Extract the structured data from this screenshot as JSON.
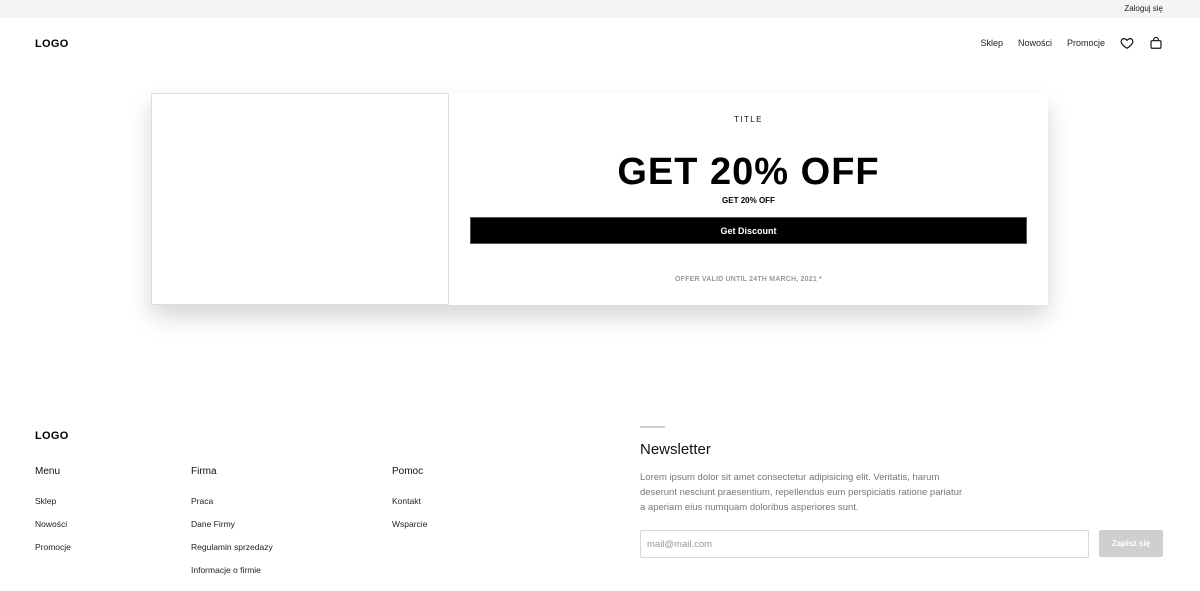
{
  "topbar": {
    "login_label": "Zaloguj się"
  },
  "header": {
    "logo": "LOGO",
    "nav": [
      {
        "label": "Sklep"
      },
      {
        "label": "Nowości"
      },
      {
        "label": "Promocje"
      }
    ],
    "icons": [
      "heart-icon",
      "shopping-bag-icon"
    ]
  },
  "promo": {
    "title": "TITLE",
    "headline": "GET 20% OFF",
    "subheadline": "GET 20% OFF",
    "button_label": "Get Discount",
    "validity": "OFFER VALID UNTIL 24TH MARCH, 2021 *"
  },
  "footer": {
    "logo": "LOGO",
    "columns": [
      {
        "heading": "Menu",
        "links": [
          "Sklep",
          "Nowości",
          "Promocje"
        ]
      },
      {
        "heading": "Firma",
        "links": [
          "Praca",
          "Dane Firmy",
          "Regulamin sprzedazy",
          "Informacje o firmie"
        ]
      },
      {
        "heading": "Pomoc",
        "links": [
          "Kontakt",
          "Wsparcie"
        ]
      }
    ],
    "newsletter": {
      "heading": "Newsletter",
      "text": "Lorem ipsum dolor sit amet consectetur adipisicing elit. Veritatis, harum deserunt nesciunt praesentium, repellendus eum perspiciatis ratione pariatur a aperiam eius numquam doloribus asperiores sunt.",
      "input_placeholder": "mail@mail.com",
      "button_label": "Zapisz się"
    }
  },
  "colors": {
    "topbar_bg": "#f4f4f4",
    "button_primary": "#000000",
    "button_disabled": "#cfcfcf",
    "muted_text": "#9a9a9a"
  }
}
